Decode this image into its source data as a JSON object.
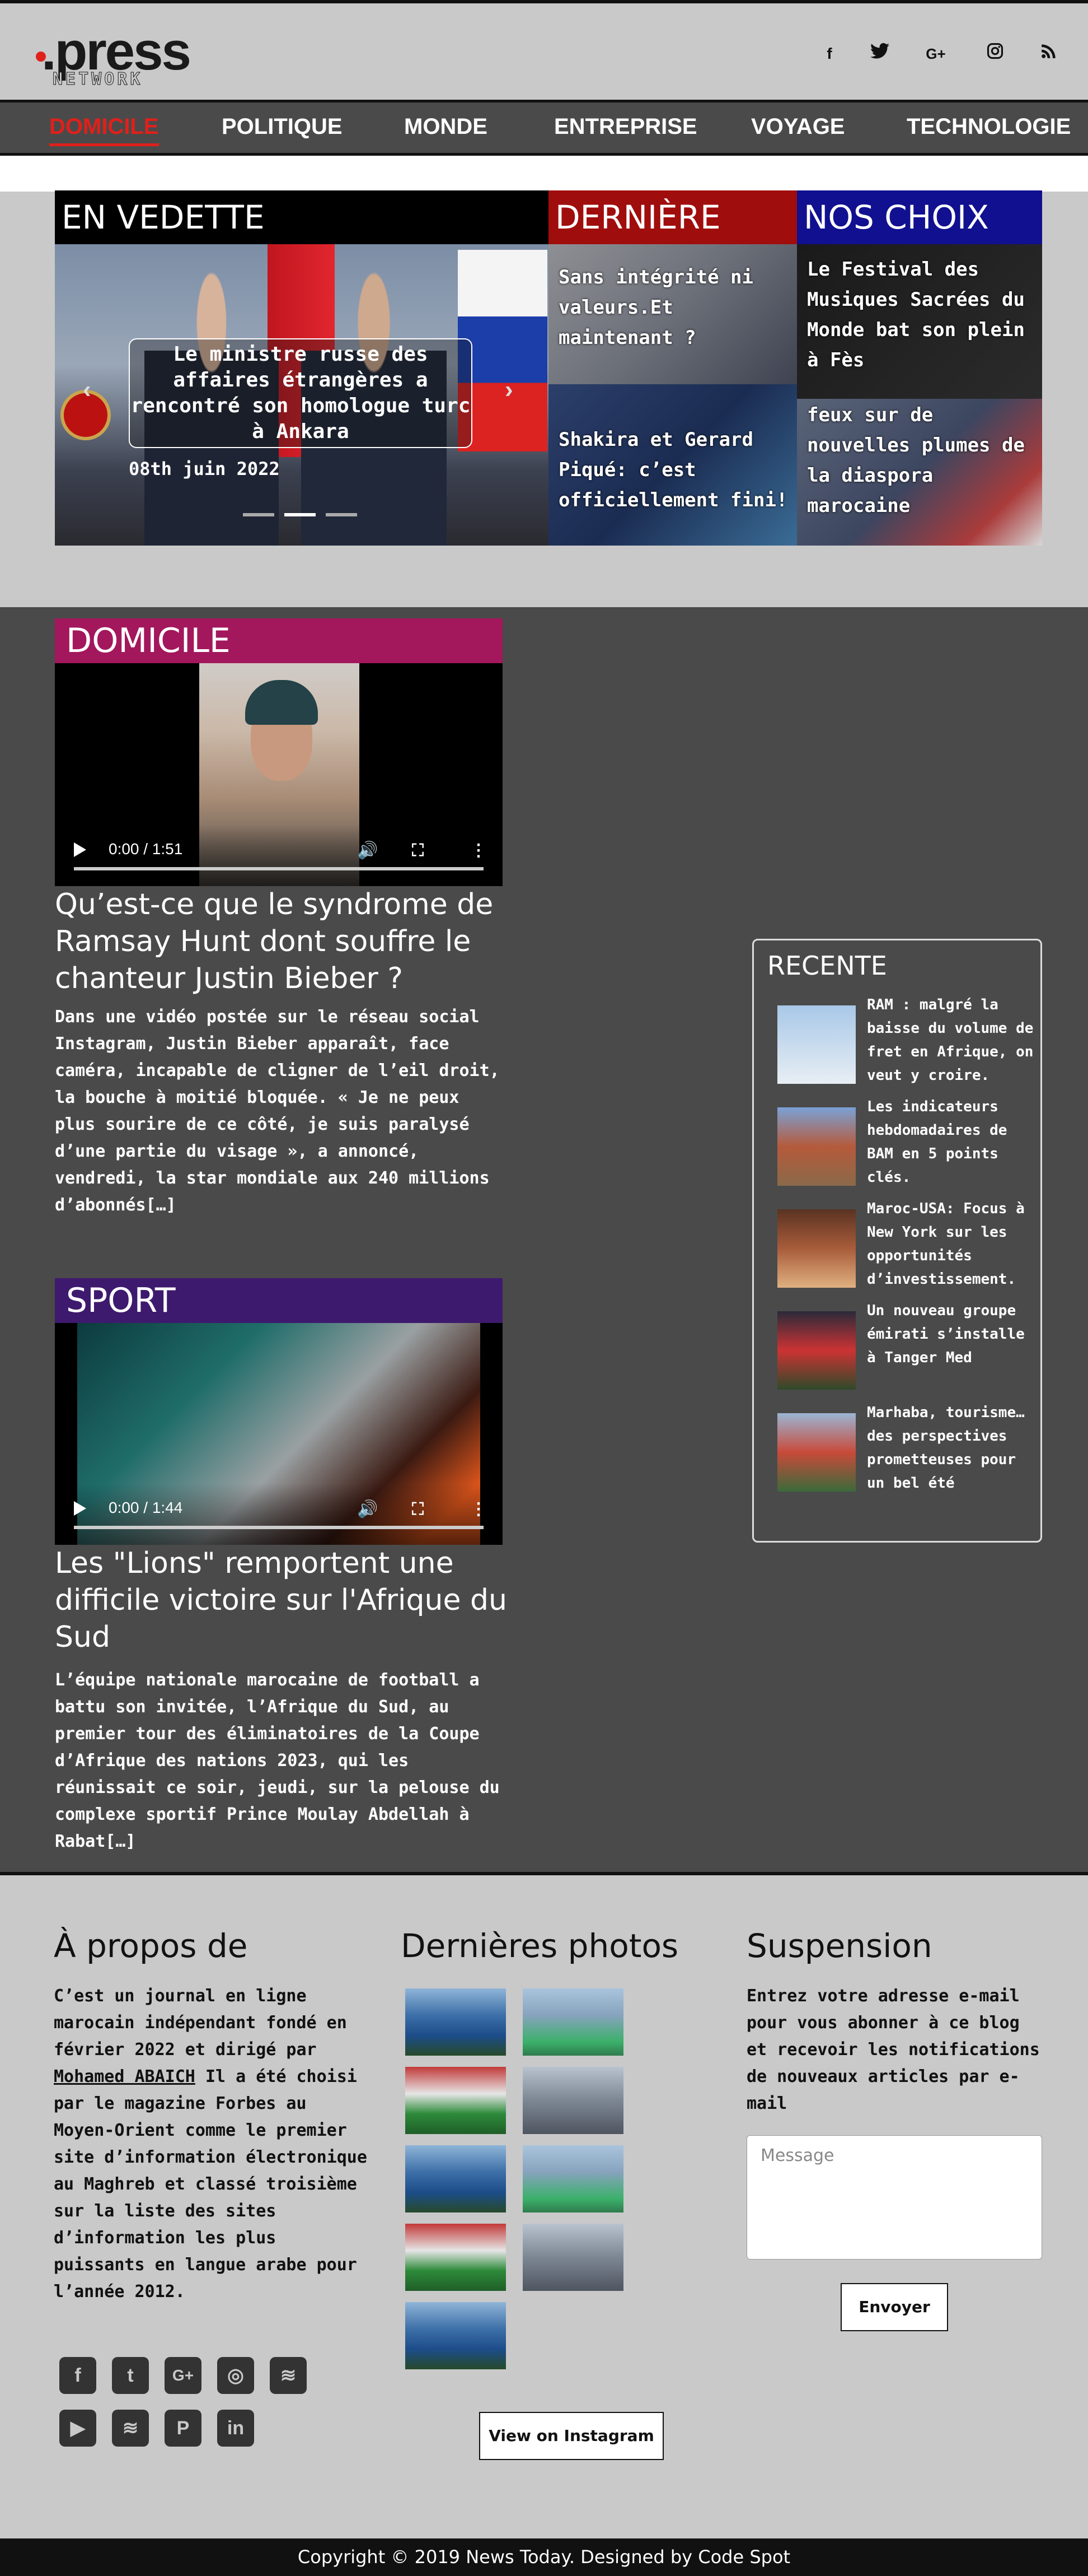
{
  "header": {
    "logo_text": ".press",
    "logo_sub": "NETWORK",
    "social": [
      "f",
      "t",
      "G+",
      "ig",
      "rss"
    ]
  },
  "nav": {
    "items": [
      "DOMICILE",
      "POLITIQUE",
      "MONDE",
      "ENTREPRISE",
      "VOYAGE",
      "TECHNOLOGIE"
    ]
  },
  "featured": {
    "vedette_title": "EN VEDETTE",
    "derniere_title": "DERNIÈRE",
    "choix_title": "NOS CHOIX",
    "slide_caption": "Le ministre russe des affaires étrangères a rencontré son homologue turc à Ankara",
    "slide_date": "08th juin 2022",
    "derniere_items": [
      "Sans intégrité ni valeurs.Et maintenant ?",
      "Shakira et Gerard Piqué: c’est officiellement fini!"
    ],
    "choix_items": [
      "Le Festival des Musiques Sacrées du Monde bat son plein à Fès",
      "feux sur de nouvelles plumes de la diaspora marocaine"
    ]
  },
  "domicile": {
    "section_title": "DOMICILE",
    "video_time": "0:00 / 1:51",
    "title": "Qu’est-ce que le syndrome de Ramsay Hunt dont souffre le chanteur Justin Bieber ?",
    "body": "Dans une vidéo postée sur le réseau social Instagram, Justin Bieber apparaît, face caméra, incapable de cligner de l’eil droit, la bouche à moitié bloquée. « Je ne peux plus sourire de ce côté, je suis paralysé d’une partie du visage », a annoncé, vendredi, la star mondiale aux 240 millions d’abonnés[…]"
  },
  "sport": {
    "section_title": "SPORT",
    "video_time": "0:00 / 1:44",
    "title": "Les \"Lions\" remportent une difficile victoire sur l'Afrique du Sud",
    "body": "L’équipe nationale marocaine de football a battu son invitée, l’Afrique du Sud, au premier tour des éliminatoires de la Coupe d’Afrique des nations 2023, qui les réunissait ce soir, jeudi, sur la pelouse du complexe sportif Prince Moulay Abdellah à Rabat[…]"
  },
  "recente": {
    "title": "RECENTE",
    "items": [
      "RAM : malgré la baisse du volume de fret en Afrique, on veut y croire.",
      "Les indicateurs hebdomadaires de BAM en 5 points clés.",
      "Maroc-USA: Focus à New York sur les opportunités d’investissement.",
      "Un nouveau groupe émirati s’installe à Tanger Med",
      "Marhaba, tourisme… des perspectives prometteuses pour un bel été"
    ]
  },
  "footer": {
    "about_title": "À propos de",
    "about_text_1": "C’est un journal en ligne marocain indépendant fondé en février 2022 et dirigé par",
    "about_link": "Mohamed ABAICH",
    "about_text_2": "Il a été choisi par le magazine Forbes au Moyen-Orient comme le premier site d’information électronique au Maghreb et classé troisième sur la liste des sites d’information les plus puissants en langue arabe pour l’année 2012.",
    "photos_title": "Dernières photos",
    "instagram_button": "View on Instagram",
    "subscribe_title": "Suspension",
    "subscribe_text": "Entrez votre adresse e-mail pour vous abonner à ce blog et recevoir les notifications de nouveaux articles par e-mail",
    "message_placeholder": "Message",
    "send_button": "Envoyer",
    "copyright": "Copyright © 2019 News Today. Designed by Code Spot"
  }
}
